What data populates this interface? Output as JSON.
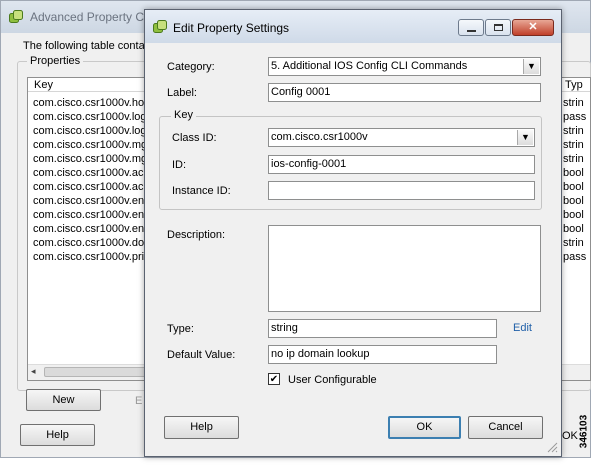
{
  "background_window": {
    "title": "Advanced Property C",
    "description": "The following table conta",
    "properties_group": "Properties",
    "column_key": "Key",
    "column_type": "Typ",
    "rows": [
      {
        "key": "com.cisco.csr1000v.ho",
        "type": "strin"
      },
      {
        "key": "com.cisco.csr1000v.log",
        "type": "pass"
      },
      {
        "key": "com.cisco.csr1000v.log",
        "type": "strin"
      },
      {
        "key": "com.cisco.csr1000v.mg",
        "type": "strin"
      },
      {
        "key": "com.cisco.csr1000v.mg",
        "type": "strin"
      },
      {
        "key": "com.cisco.csr1000v.ac",
        "type": "bool"
      },
      {
        "key": "com.cisco.csr1000v.ac",
        "type": "bool"
      },
      {
        "key": "com.cisco.csr1000v.en",
        "type": "bool"
      },
      {
        "key": "com.cisco.csr1000v.en",
        "type": "bool"
      },
      {
        "key": "com.cisco.csr1000v.en",
        "type": "bool"
      },
      {
        "key": "com.cisco.csr1000v.do",
        "type": "strin"
      },
      {
        "key": "com.cisco.csr1000v.pri",
        "type": "pass"
      }
    ],
    "new_button": "New",
    "edit_button_partial": "E",
    "help_button": "Help",
    "ok_partial": "OK"
  },
  "dialog": {
    "title": "Edit Property Settings",
    "category_label": "Category:",
    "category_value": "5. Additional IOS Config CLI Commands",
    "label_label": "Label:",
    "label_value": "Config 0001",
    "key_group": "Key",
    "class_id_label": "Class ID:",
    "class_id_value": "com.cisco.csr1000v",
    "id_label": "ID:",
    "id_value": "ios-config-0001",
    "instance_id_label": "Instance ID:",
    "instance_id_value": "",
    "description_label": "Description:",
    "description_value": "",
    "type_label": "Type:",
    "type_value": "string",
    "edit_link": "Edit",
    "default_value_label": "Default Value:",
    "default_value_value": "no ip domain lookup",
    "user_configurable_label": "User Configurable",
    "user_configurable_checked": true,
    "help_button": "Help",
    "ok_button": "OK",
    "cancel_button": "Cancel"
  },
  "side_tag": "346103",
  "icons": {
    "app": "vsphere-app-icon",
    "minimize": "minimize-icon",
    "maximize": "maximize-icon",
    "close": "close-icon",
    "dropdown": "chevron-down-icon",
    "check": "checkmark-icon",
    "resize": "resize-grip-icon"
  },
  "colors": {
    "title_bar": "#cfdae8",
    "close_button": "#c0402a",
    "link": "#1f5fa8",
    "window_bg": "#f0f0f0"
  }
}
